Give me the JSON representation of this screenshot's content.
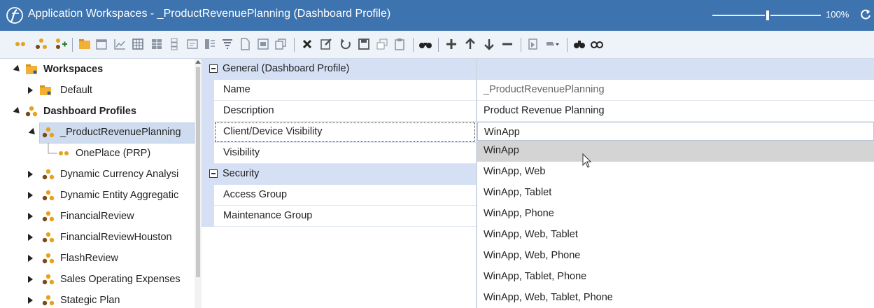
{
  "window": {
    "title": "Application Workspaces - _ProductRevenuePlanning (Dashboard Profile)",
    "zoom_label": "100%",
    "zoom_level": 1.0
  },
  "icons": {
    "app": "application-logo-icon",
    "refresh": "refresh-icon"
  },
  "toolbar": {
    "buttons": [
      "connect-icon",
      "hierarchy-icon",
      "add-child-icon",
      "workspace-icon",
      "calendar-icon",
      "chart-icon",
      "grid-icon",
      "table-icon",
      "list-icon",
      "form-icon",
      "columns-icon",
      "filter-icon",
      "document-icon",
      "panel-icon",
      "copy-window-icon",
      "delete-icon",
      "edit-icon",
      "undo-icon",
      "save-icon",
      "copy-icon",
      "paste-icon",
      "binoculars-icon",
      "add-icon",
      "move-up-icon",
      "move-down-icon",
      "remove-icon",
      "assign-icon",
      "run-dropdown-icon",
      "search-replace-icon",
      "link-icon"
    ]
  },
  "tree": {
    "items": [
      {
        "label": "Workspaces",
        "bold": true
      },
      {
        "label": "Default",
        "bold": false
      },
      {
        "label": "Dashboard Profiles",
        "bold": true
      },
      {
        "label": "_ProductRevenuePlanning",
        "bold": false
      },
      {
        "label": "OnePlace (PRP)",
        "bold": false
      },
      {
        "label": "Dynamic Currency Analysi",
        "bold": false
      },
      {
        "label": "Dynamic Entity Aggregatic",
        "bold": false
      },
      {
        "label": "FinancialReview",
        "bold": false
      },
      {
        "label": "FinancialReviewHouston",
        "bold": false
      },
      {
        "label": "FlashReview",
        "bold": false
      },
      {
        "label": "Sales Operating Expenses",
        "bold": false
      },
      {
        "label": "Stategic Plan",
        "bold": false
      }
    ]
  },
  "properties": {
    "general_category": "General (Dashboard Profile)",
    "security_category": "Security",
    "rows": [
      {
        "name": "Name",
        "value": "_ProductRevenuePlanning"
      },
      {
        "name": "Description",
        "value": "Product Revenue Planning"
      },
      {
        "name": "Client/Device Visibility",
        "value": "WinApp"
      },
      {
        "name": "Visibility",
        "value": ""
      },
      {
        "name": "Access Group",
        "value": ""
      },
      {
        "name": "Maintenance Group",
        "value": ""
      }
    ]
  },
  "dropdown": {
    "options": [
      "WinApp",
      "WinApp, Web",
      "WinApp, Tablet",
      "WinApp, Phone",
      "WinApp, Web, Tablet",
      "WinApp, Web, Phone",
      "WinApp, Tablet, Phone",
      "WinApp, Web, Tablet, Phone"
    ],
    "highlighted": "WinApp"
  },
  "colors": {
    "title_bar": "#3d73ae",
    "category_bg": "#d5e0f4",
    "hover_bg": "#d4d4d4",
    "profile_icon": "#e6a21a"
  }
}
